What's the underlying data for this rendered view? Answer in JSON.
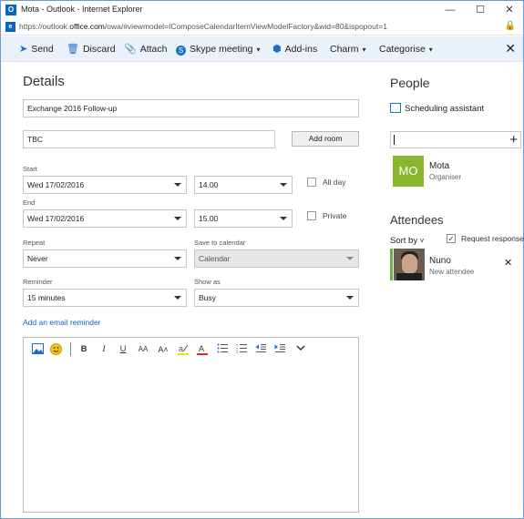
{
  "window": {
    "title": "Mota - Outlook - Internet Explorer",
    "app_icon": "outlook-icon",
    "controls": {
      "minimize": "—",
      "maximize": "☐",
      "close": "✕"
    }
  },
  "address": {
    "url_prefix": "https://outlook.",
    "url_domain": "office.com",
    "url_path": "/owa/#viewmodel=IComposeCalendarItemViewModelFactory&wid=80&ispopout=1"
  },
  "toolbar": {
    "send": "Send",
    "discard": "Discard",
    "attach": "Attach",
    "skype": "Skype meeting",
    "addins": "Add-ins",
    "charm": "Charm",
    "categorise": "Categorise"
  },
  "details": {
    "heading": "Details",
    "subject": "Exchange 2016 Follow-up",
    "location": "TBC",
    "add_room": "Add room",
    "start_label": "Start",
    "start_date": "Wed 17/02/2016",
    "start_time": "14.00",
    "all_day": "All day",
    "end_label": "End",
    "end_date": "Wed 17/02/2016",
    "end_time": "15.00",
    "private": "Private",
    "repeat_label": "Repeat",
    "repeat_value": "Never",
    "save_label": "Save to calendar",
    "save_value": "Calendar",
    "reminder_label": "Reminder",
    "reminder_value": "15 minutes",
    "showas_label": "Show as",
    "showas_value": "Busy",
    "email_reminder": "Add an email reminder"
  },
  "people": {
    "heading": "People",
    "scheduling": "Scheduling assistant",
    "organiser_initials": "MO",
    "organiser_name": "Mota",
    "organiser_role": "Organiser",
    "attendees_heading": "Attendees",
    "sort_by": "Sort by",
    "request_responses": "Request responses",
    "attendee_name": "Nuno",
    "attendee_status": "New attendee"
  },
  "colors": {
    "accent": "#0a64c6",
    "toolbar_bg": "#eaf1fb",
    "organiser_avatar": "#8ab62f",
    "attendee_bar": "#6cb04a"
  }
}
